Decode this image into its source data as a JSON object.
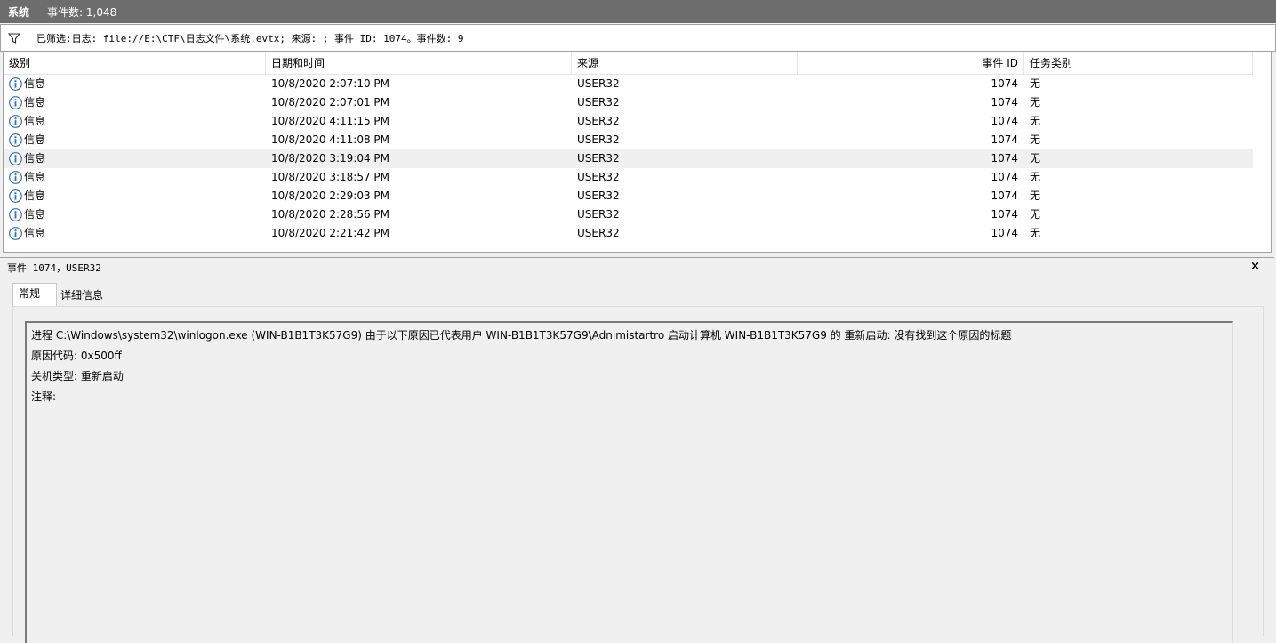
{
  "titlebar": {
    "name": "系统",
    "count": "事件数: 1,048"
  },
  "filter": {
    "icon": "funnel-icon",
    "text": "已筛选:日志: file://E:\\CTF\\日志文件\\系统.evtx; 来源: ; 事件 ID: 1074。事件数: 9"
  },
  "columns": {
    "level": "级别",
    "datetime": "日期和时间",
    "source": "来源",
    "event_id": "事件 ID",
    "task": "任务类别"
  },
  "rows": [
    {
      "level": "信息",
      "datetime": "10/8/2020 2:07:10 PM",
      "source": "USER32",
      "event_id": "1074",
      "task": "无"
    },
    {
      "level": "信息",
      "datetime": "10/8/2020 2:07:01 PM",
      "source": "USER32",
      "event_id": "1074",
      "task": "无"
    },
    {
      "level": "信息",
      "datetime": "10/8/2020 4:11:15 PM",
      "source": "USER32",
      "event_id": "1074",
      "task": "无"
    },
    {
      "level": "信息",
      "datetime": "10/8/2020 4:11:08 PM",
      "source": "USER32",
      "event_id": "1074",
      "task": "无"
    },
    {
      "level": "信息",
      "datetime": "10/8/2020 3:19:04 PM",
      "source": "USER32",
      "event_id": "1074",
      "task": "无"
    },
    {
      "level": "信息",
      "datetime": "10/8/2020 3:18:57 PM",
      "source": "USER32",
      "event_id": "1074",
      "task": "无"
    },
    {
      "level": "信息",
      "datetime": "10/8/2020 2:29:03 PM",
      "source": "USER32",
      "event_id": "1074",
      "task": "无"
    },
    {
      "level": "信息",
      "datetime": "10/8/2020 2:28:56 PM",
      "source": "USER32",
      "event_id": "1074",
      "task": "无"
    },
    {
      "level": "信息",
      "datetime": "10/8/2020 2:21:42 PM",
      "source": "USER32",
      "event_id": "1074",
      "task": "无"
    }
  ],
  "selected_row_index": 4,
  "detail": {
    "title": "事件 1074，USER32",
    "close": "×",
    "tabs": [
      "常规",
      "详细信息"
    ],
    "message": [
      "进程 C:\\Windows\\system32\\winlogon.exe (WIN-B1B1T3K57G9) 由于以下原因已代表用户 WIN-B1B1T3K57G9\\Adnimistartro 启动计算机 WIN-B1B1T3K57G9 的 重新启动: 没有找到这个原因的标题",
      "原因代码: 0x500ff",
      "关机类型: 重新启动",
      "注释:"
    ]
  },
  "colors": {
    "titlebar_bg": "#6d6d6d",
    "info_icon": "#2f6fbf",
    "selected_row_bg": "#f0f0f0"
  }
}
